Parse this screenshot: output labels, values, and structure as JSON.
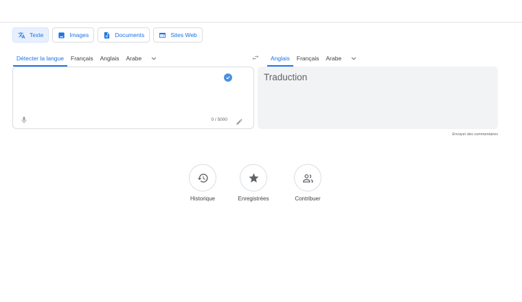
{
  "modes": [
    {
      "label": "Texte",
      "icon": "translate-icon",
      "active": true
    },
    {
      "label": "Images",
      "icon": "image-icon",
      "active": false
    },
    {
      "label": "Documents",
      "icon": "document-icon",
      "active": false
    },
    {
      "label": "Sites Web",
      "icon": "web-icon",
      "active": false
    }
  ],
  "source_langs": {
    "detect": "Détecter la langue",
    "items": [
      "Français",
      "Anglais",
      "Arabe"
    ]
  },
  "target_langs": {
    "items": [
      "Anglais",
      "Français",
      "Arabe"
    ]
  },
  "source": {
    "counter": "0 / 5000"
  },
  "target": {
    "placeholder": "Traduction"
  },
  "feedback": "Envoyer des commentaires",
  "actions": [
    {
      "label": "Historique",
      "icon": "history-icon"
    },
    {
      "label": "Enregistrées",
      "icon": "star-icon"
    },
    {
      "label": "Contribuer",
      "icon": "people-icon"
    }
  ],
  "colors": {
    "accent": "#1a73e8",
    "check": "#4a90e2",
    "output_bg": "#f1f3f4"
  }
}
